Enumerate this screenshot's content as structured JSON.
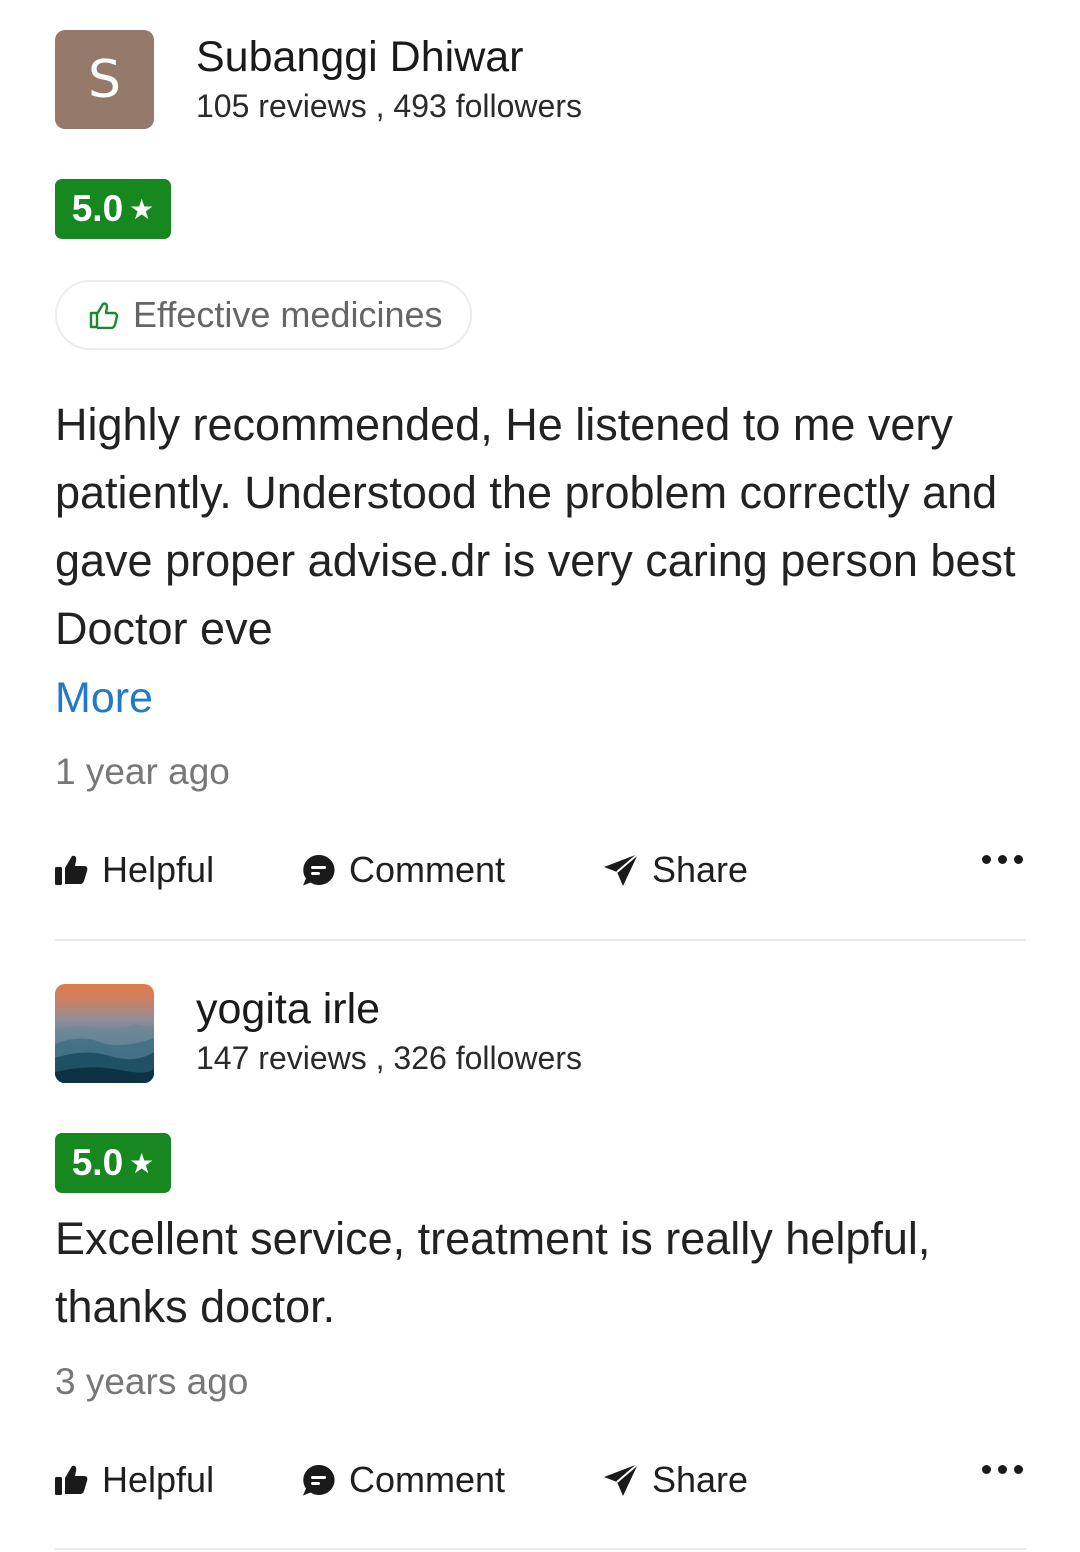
{
  "reviews": [
    {
      "user": {
        "initial": "S",
        "name": "Subanggi Dhiwar",
        "meta": "105 reviews , 493 followers",
        "avatar_color": "#957a6c"
      },
      "rating": "5.0",
      "tag": "Effective medicines",
      "text": "Highly recommended, He listened to me very patiently. Understood the problem correctly and gave proper advise.dr is very caring person best Doctor eve",
      "more_label": "More",
      "time": "1 year ago",
      "actions": {
        "helpful": "Helpful",
        "comment": "Comment",
        "share": "Share"
      }
    },
    {
      "user": {
        "name": "yogita irle",
        "meta": "147 reviews , 326 followers"
      },
      "rating": "5.0",
      "text": "Excellent service, treatment is really helpful, thanks doctor.",
      "time": "3 years ago",
      "actions": {
        "helpful": "Helpful",
        "comment": "Comment",
        "share": "Share"
      }
    }
  ],
  "colors": {
    "rating_bg": "#16881f",
    "link": "#1f7ac9",
    "divider": "#ebebeb"
  },
  "icons": [
    "thumbs-up-outline-icon",
    "thumbs-up-icon",
    "comment-icon",
    "share-icon",
    "more-options-icon",
    "star-icon"
  ]
}
